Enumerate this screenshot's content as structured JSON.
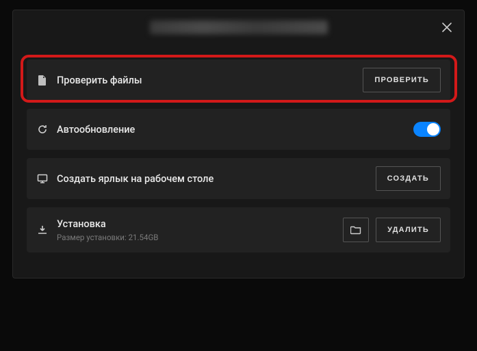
{
  "header": {
    "close_aria": "Close"
  },
  "rows": {
    "verify": {
      "label": "Проверить файлы",
      "button": "ПРОВЕРИТЬ"
    },
    "autoupdate": {
      "label": "Автообновление",
      "enabled": true
    },
    "shortcut": {
      "label": "Создать ярлык на рабочем столе",
      "button": "СОЗДАТЬ"
    },
    "install": {
      "label": "Установка",
      "sublabel": "Размер установки: 21.54GB",
      "button": "УДАЛИТЬ",
      "browse_aria": "Browse"
    }
  }
}
